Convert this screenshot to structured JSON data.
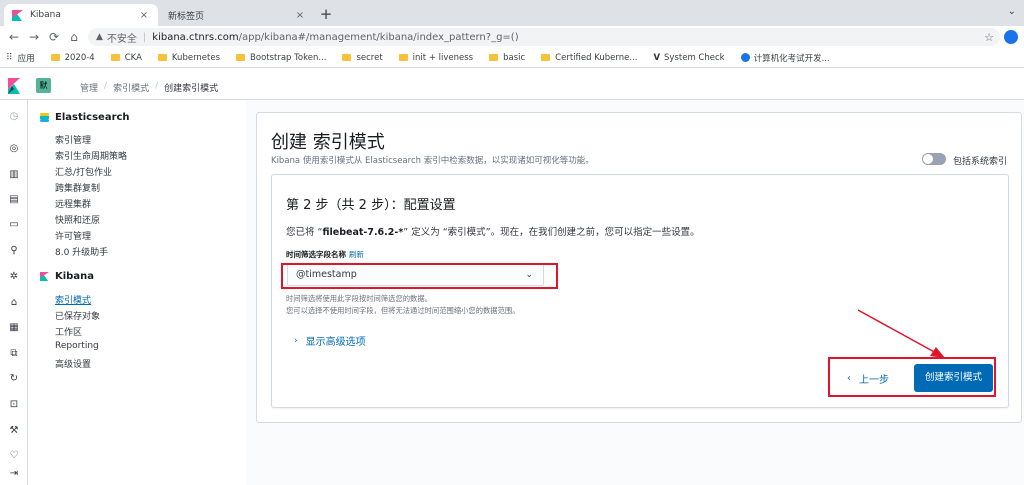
{
  "browser": {
    "tabs": [
      {
        "title": "Kibana",
        "close": "×"
      },
      {
        "title": "新标签页",
        "close": "×"
      }
    ],
    "new_tab": "+",
    "window_controls": "⌄",
    "omnibox": {
      "security_label": "不安全",
      "separator": "|",
      "host": "kibana.ctnrs.com",
      "path": "/app/kibana#/management/kibana/index_pattern?_g=()"
    },
    "bookmarks": [
      {
        "label": "应用",
        "icon": "apps-grid-icon"
      },
      {
        "label": "2020-4",
        "icon": "folder-icon"
      },
      {
        "label": "CKA",
        "icon": "folder-icon"
      },
      {
        "label": "Kubernetes",
        "icon": "folder-icon"
      },
      {
        "label": "Bootstrap Token...",
        "icon": "folder-icon"
      },
      {
        "label": "secret",
        "icon": "folder-icon"
      },
      {
        "label": "init + liveness",
        "icon": "folder-icon"
      },
      {
        "label": "basic",
        "icon": "folder-icon"
      },
      {
        "label": "Certified Kuberne...",
        "icon": "folder-icon"
      },
      {
        "label": "System Check",
        "icon": "vlogo-icon"
      },
      {
        "label": "计算机化考试开发...",
        "icon": "pearson-icon"
      }
    ]
  },
  "kibana": {
    "space_badge": "默",
    "breadcrumbs": {
      "management": "管理",
      "index_patterns": "索引模式",
      "current": "创建索引模式"
    },
    "sidebar": {
      "elasticsearch_title": "Elasticsearch",
      "elasticsearch_items": [
        "索引管理",
        "索引生命周期策略",
        "汇总/打包作业",
        "跨集群复制",
        "远程集群",
        "快照和还原",
        "许可管理",
        "8.0 升级助手"
      ],
      "kibana_title": "Kibana",
      "kibana_items": [
        "索引模式",
        "已保存对象",
        "工作区",
        "Reporting",
        "高级设置"
      ],
      "active_item": "索引模式"
    },
    "page": {
      "title": "创建 索引模式",
      "description": "Kibana 使用索引模式从 Elasticsearch 索引中检索数据，以实现诸如可视化等功能。",
      "include_system_label": "包括系统索引",
      "include_system_on": false
    },
    "step": {
      "title": "第 2 步（共 2 步）：配置设置",
      "desc_prefix": "您已将 “",
      "pattern": "filebeat-7.6.2-*",
      "desc_suffix": "” 定义为 “索引模式”。现在，在我们创建之前，您可以指定一些设置。",
      "time_field_label": "时间筛选字段名称",
      "refresh_label": "刷新",
      "time_field_value": "@timestamp",
      "help_line1": "时间筛选将使用此字段按时间筛选您的数据。",
      "help_line2": "您可以选择不使用时间字段，但将无法通过时间范围缩小您的数据范围。",
      "advanced_label": "显示高级选项",
      "back_label": "上一步",
      "create_label": "创建索引模式"
    }
  },
  "colors": {
    "primary": "#006bb4",
    "highlight": "#e0142b"
  }
}
